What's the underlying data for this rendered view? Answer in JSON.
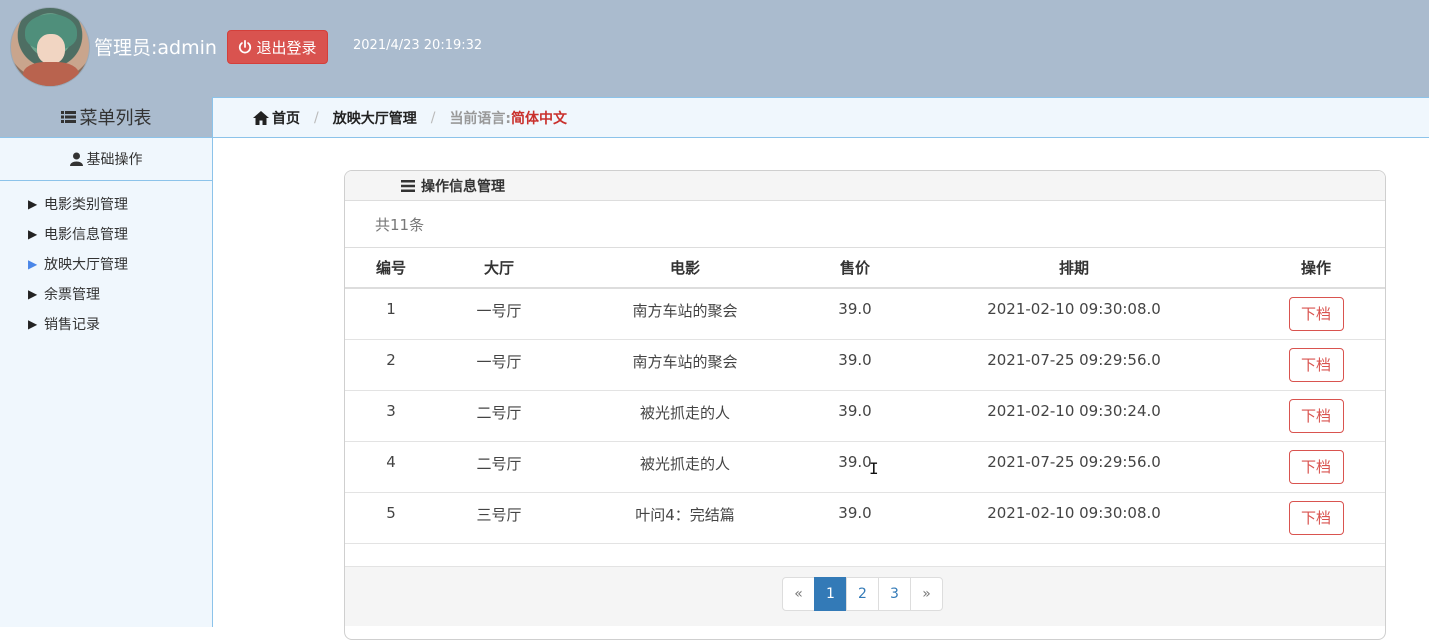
{
  "header": {
    "admin_label": "管理员:admin",
    "logout_label": "退出登录",
    "datetime": "2021/4/23 20:19:32"
  },
  "sidebar": {
    "title": "菜单列表",
    "section": "基础操作",
    "items": [
      {
        "label": "电影类别管理",
        "active": false
      },
      {
        "label": "电影信息管理",
        "active": false
      },
      {
        "label": "放映大厅管理",
        "active": true
      },
      {
        "label": "余票管理",
        "active": false
      },
      {
        "label": "销售记录",
        "active": false
      }
    ]
  },
  "breadcrumb": {
    "home": "首页",
    "current": "放映大厅管理",
    "lang_label": "当前语言:",
    "lang_value": "简体中文"
  },
  "panel": {
    "title": "操作信息管理",
    "count": "共11条",
    "columns": [
      "编号",
      "大厅",
      "电影",
      "售价",
      "排期",
      "操作"
    ],
    "rows": [
      {
        "id": "1",
        "hall": "一号厅",
        "movie": "南方车站的聚会",
        "price": "39.0",
        "schedule": "2021-02-10 09:30:08.0",
        "action": "下档"
      },
      {
        "id": "2",
        "hall": "一号厅",
        "movie": "南方车站的聚会",
        "price": "39.0",
        "schedule": "2021-07-25 09:29:56.0",
        "action": "下档"
      },
      {
        "id": "3",
        "hall": "二号厅",
        "movie": "被光抓走的人",
        "price": "39.0",
        "schedule": "2021-02-10 09:30:24.0",
        "action": "下档"
      },
      {
        "id": "4",
        "hall": "二号厅",
        "movie": "被光抓走的人",
        "price": "39.0",
        "schedule": "2021-07-25 09:29:56.0",
        "action": "下档"
      },
      {
        "id": "5",
        "hall": "三号厅",
        "movie": "叶问4：完结篇",
        "price": "39.0",
        "schedule": "2021-02-10 09:30:08.0",
        "action": "下档"
      }
    ]
  },
  "pagination": {
    "prev": "«",
    "pages": [
      "1",
      "2",
      "3"
    ],
    "current": "1",
    "next": "»"
  },
  "colors": {
    "header_bg": "#aabbce",
    "danger": "#d9534f",
    "primary": "#337ab7",
    "sidebar_bg": "#f0f7fd"
  }
}
